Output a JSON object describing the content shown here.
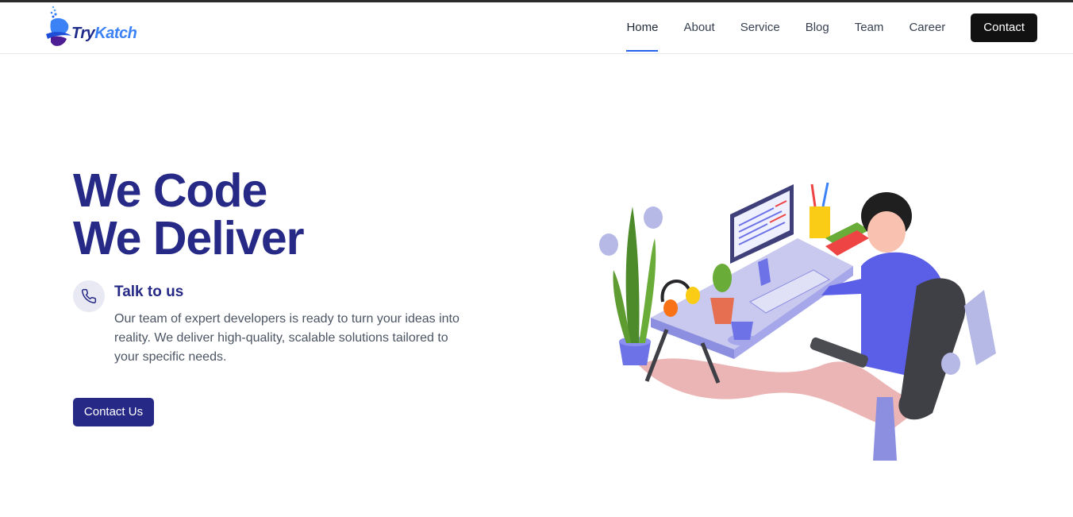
{
  "header": {
    "logo_text_a": "Try",
    "logo_text_b": "Katch",
    "nav": [
      {
        "label": "Home",
        "active": true
      },
      {
        "label": "About"
      },
      {
        "label": "Service"
      },
      {
        "label": "Blog"
      },
      {
        "label": "Team"
      },
      {
        "label": "Career"
      }
    ],
    "contact_label": "Contact"
  },
  "hero": {
    "title_line1": "We Code",
    "title_line2": "We Deliver",
    "talk_title": "Talk to us",
    "talk_desc": "Our team of expert developers is ready to turn your ideas into reality. We deliver high-quality, scalable solutions tailored to your specific needs.",
    "cta_label": "Contact Us"
  },
  "icons": {
    "phone": "phone-icon",
    "logo": "trykatch-logo"
  },
  "colors": {
    "primary": "#262a86",
    "nav_active_underline": "#2563eb",
    "dark_button": "#111111",
    "text_muted": "#4b5563"
  }
}
